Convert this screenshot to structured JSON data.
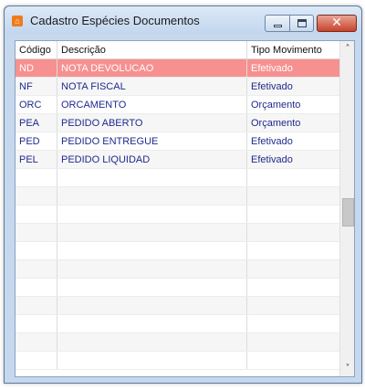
{
  "window": {
    "title": "Cadastro Espécies Documentos",
    "app_icon": "house-icon"
  },
  "controls": {
    "minimize_icon": "minimize-icon",
    "maximize_icon": "maximize-icon",
    "close_icon": "close-icon"
  },
  "columns": [
    "Código",
    "Descrição",
    "Tipo Movimento"
  ],
  "rows": [
    [
      "ND",
      "NOTA DEVOLUCAO",
      "Efetivado"
    ],
    [
      "NF",
      "NOTA FISCAL",
      "Efetivado"
    ],
    [
      "ORC",
      "ORCAMENTO",
      "Orçamento"
    ],
    [
      "PEA",
      "PEDIDO ABERTO",
      "Orçamento"
    ],
    [
      "PED",
      "PEDIDO ENTREGUE",
      "Efetivado"
    ],
    [
      "PEL",
      "PEDIDO LIQUIDAD",
      "Efetivado"
    ]
  ],
  "selected_row": 0,
  "colors": {
    "selection": "#f79090",
    "text": "#1f2a8c",
    "frame": "#c5d8ee"
  }
}
